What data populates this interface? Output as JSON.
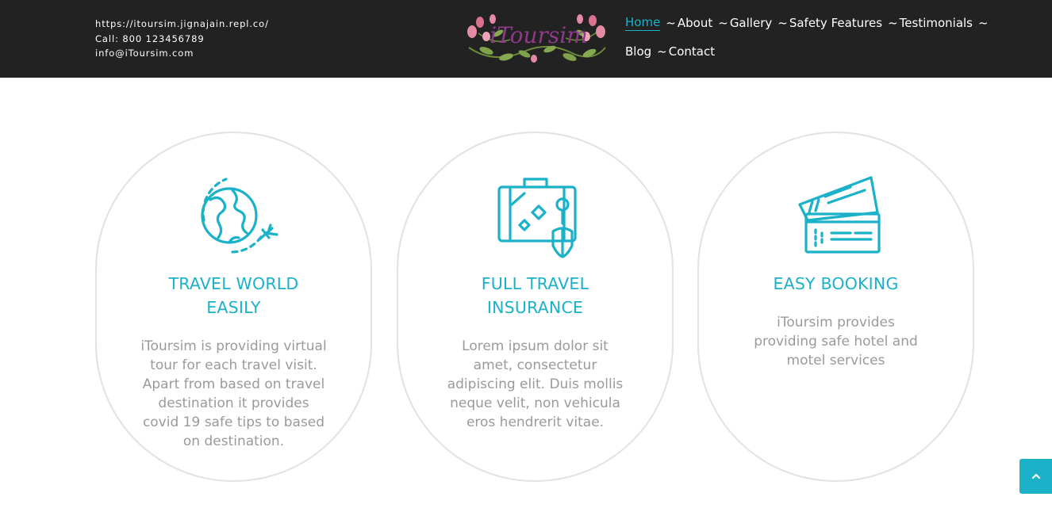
{
  "header": {
    "contact": {
      "url": "https://itoursim.jignajain.repl.co/",
      "phone": "Call: 800 123456789",
      "email": "info@iToursim.com"
    },
    "logo_text": "iToursim",
    "nav": {
      "separator": "~",
      "items": [
        {
          "label": "Home",
          "active": true
        },
        {
          "label": "About"
        },
        {
          "label": "Gallery"
        },
        {
          "label": "Safety Features"
        },
        {
          "label": "Testimonials"
        },
        {
          "label": "Blog"
        },
        {
          "label": "Contact"
        }
      ]
    }
  },
  "features": [
    {
      "icon": "globe-plane-icon",
      "title_lines": [
        "TRAVEL WORLD",
        "EASILY"
      ],
      "text_lines": [
        "iToursim is providing virtual",
        "tour for each travel visit.",
        "Apart from based on travel",
        "destination it provides",
        "covid 19 safe tips to based",
        "on destination."
      ]
    },
    {
      "icon": "suitcase-icon",
      "title_lines": [
        "FULL TRAVEL",
        "INSURANCE"
      ],
      "text_lines": [
        "Lorem ipsum dolor sit",
        "amet, consectetur",
        "adipiscing elit. Duis mollis",
        "neque velit, non vehicula",
        "eros hendrerit vitae."
      ]
    },
    {
      "icon": "tickets-icon",
      "title_lines": [
        "EASY BOOKING"
      ],
      "text_lines": [
        "iToursim provides",
        "providing safe hotel and",
        "motel services"
      ]
    }
  ],
  "colors": {
    "accent": "#1ab1c9",
    "header_bg": "#222222",
    "card_border": "#e2e2e2",
    "body_text": "#9a9a9a"
  },
  "scroll_top": {
    "icon": "chevron-up-icon"
  }
}
